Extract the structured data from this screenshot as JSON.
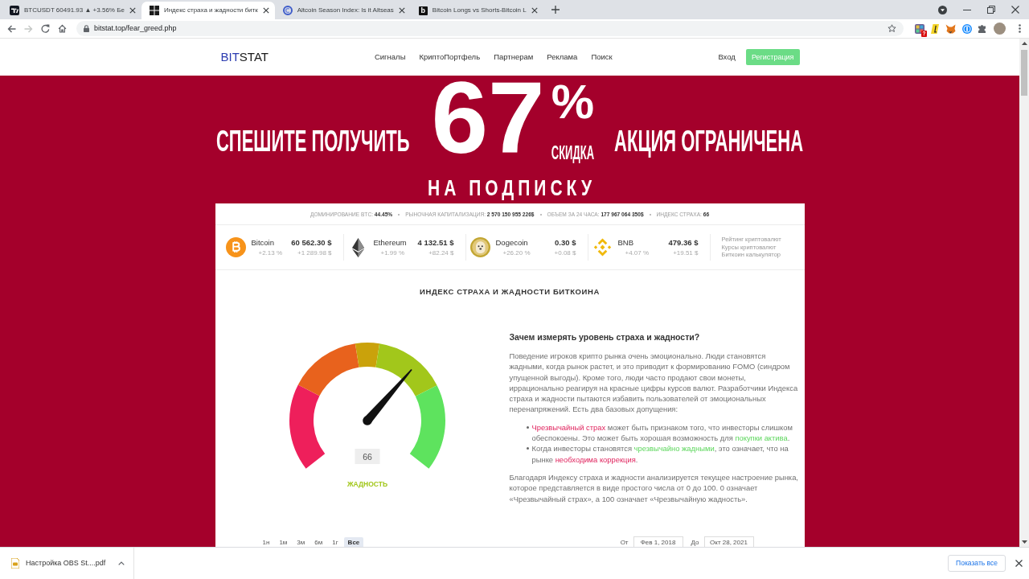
{
  "browser": {
    "tabs": [
      {
        "title": "BTCUSDT 60491.93 ▲ +3.56% Бе",
        "selected": false
      },
      {
        "title": "Индекс страха и жадности битк",
        "selected": true
      },
      {
        "title": "Altcoin Season Index: Is it Altseas",
        "selected": false
      },
      {
        "title": "Bitcoin Longs vs Shorts-Bitcoin L",
        "selected": false,
        "favicon_text": "b"
      }
    ],
    "forward_enabled": false,
    "url": "bitstat.top/fear_greed.php",
    "extension_badge": "?"
  },
  "site": {
    "logo_accent": "BIT",
    "logo_rest": "STAT",
    "nav": [
      "Сигналы",
      "КриптоПортфель",
      "Партнерам",
      "Реклама",
      "Поиск"
    ],
    "login": "Вход",
    "register": "Регистрация"
  },
  "promo": {
    "left": "СПЕШИТЕ ПОЛУЧИТЬ",
    "number": "67",
    "percent": "%",
    "discount": "СКИДКА",
    "right": "АКЦИЯ ОГРАНИЧЕНА",
    "bottom": "НА ПОДПИСКУ"
  },
  "stats": [
    {
      "label": "ДОМИНИРОВАНИЕ BTC:",
      "value": "44.45%"
    },
    {
      "label": "РЫНОЧНАЯ КАПИТАЛИЗАЦИЯ:",
      "value": "2 570 150 955 226$"
    },
    {
      "label": "ОБЪЕМ ЗА 24 ЧАСА:",
      "value": "177 967 064 350$"
    },
    {
      "label": "ИНДЕКС СТРАХА:",
      "value": "66"
    }
  ],
  "coins": [
    {
      "name": "Bitcoin",
      "price": "60 562.30 $",
      "change_pct": "+2.13 %",
      "change_abs": "+1 289.98 $"
    },
    {
      "name": "Ethereum",
      "price": "4 132.51 $",
      "change_pct": "+1.99 %",
      "change_abs": "+82.24 $"
    },
    {
      "name": "Dogecoin",
      "price": "0.30 $",
      "change_pct": "+26.20 %",
      "change_abs": "+0.08 $"
    },
    {
      "name": "BNB",
      "price": "479.36 $",
      "change_pct": "+4.07 %",
      "change_abs": "+19.51 $"
    }
  ],
  "coin_links": [
    "Рейтинг криптовалют",
    "Курсы криптовалют",
    "Биткоин калькулятор"
  ],
  "index": {
    "title": "ИНДЕКС СТРАХА И ЖАДНОСТИ БИТКОИНА",
    "gauge": {
      "level": 0.66,
      "value": "66",
      "label": "ЖАДНОСТЬ"
    },
    "article": {
      "heading": "Зачем измерять уровень страха и жадности?",
      "intro": "Поведение игроков крипто рынка очень эмоционально. Люди становятся жадными, когда рынок растет, и это приводит к формированию FOMO (синдром упущенной выгоды). Кроме того, люди часто продают свои монеты, иррационально реагируя на красные цифры курсов валют. Разработчики Индекса страха и жадности пытаются избавить пользователей от эмоциональных перенапряжений. Есть два базовых допущения:",
      "points": [
        {
          "parts": [
            {
              "text": "Чрезвычайный страх",
              "kind": "fear"
            },
            {
              "text": " может быть признаком того, что инвесторы слишком обеспокоены. Это может быть хорошая возможность для ",
              "kind": "plain"
            },
            {
              "text": "покупки актива",
              "kind": "greed"
            },
            {
              "text": ".",
              "kind": "plain"
            }
          ]
        },
        {
          "parts": [
            {
              "text": "Когда инвесторы становятся ",
              "kind": "plain"
            },
            {
              "text": "чрезвычайно жадными",
              "kind": "greed"
            },
            {
              "text": ", это означает, что на рынке ",
              "kind": "plain"
            },
            {
              "text": "необходима коррекция",
              "kind": "fear"
            },
            {
              "text": ".",
              "kind": "plain"
            }
          ]
        }
      ],
      "outro": "Благодаря Индексу страха и жадности анализируется текущее настроение рынка, которое представляется в виде простого числа от 0 до 100. 0 означает «Чрезвычайный страх», а 100 означает «Чрезвычайную жадность»."
    },
    "ranges": [
      {
        "label": "1н",
        "selected": false
      },
      {
        "label": "1м",
        "selected": false
      },
      {
        "label": "3м",
        "selected": false
      },
      {
        "label": "6м",
        "selected": false
      },
      {
        "label": "1г",
        "selected": false
      },
      {
        "label": "Все",
        "selected": true
      }
    ],
    "from_label": "От",
    "from": "Фев 1, 2018",
    "to_label": "До",
    "to": "Окт 28, 2021"
  },
  "download_bar": {
    "file": "Настройка OBS St....pdf",
    "show_all": "Показать все"
  }
}
